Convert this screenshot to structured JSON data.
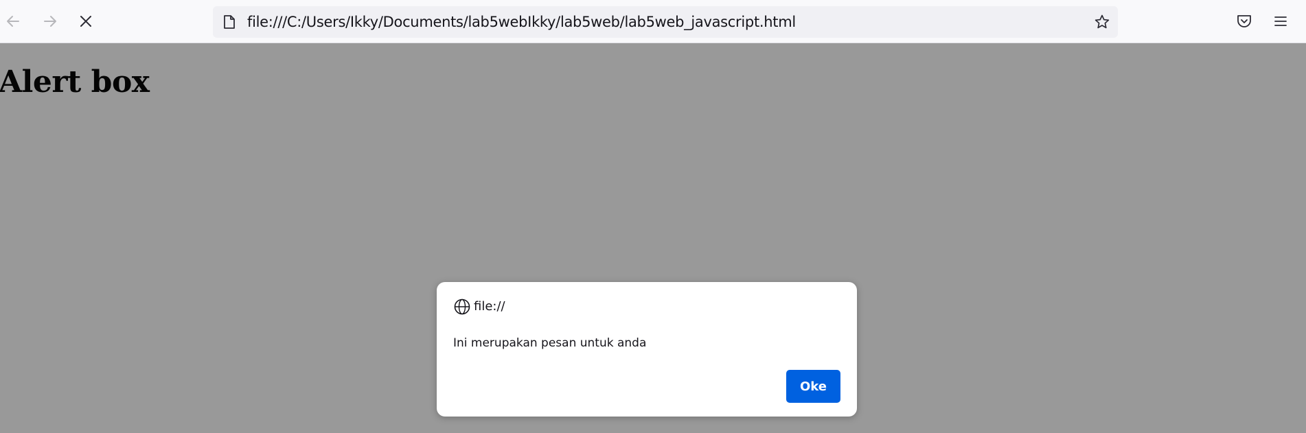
{
  "toolbar": {
    "back_icon": "back-arrow-icon",
    "forward_icon": "forward-arrow-icon",
    "stop_icon": "stop-loading-icon",
    "url": "file:///C:/Users/Ikky/Documents/lab5webIkky/lab5web/lab5web_javascript.html",
    "page_icon": "page-icon",
    "bookmark_icon": "star-icon",
    "pocket_icon": "pocket-icon",
    "menu_icon": "hamburger-menu-icon"
  },
  "page": {
    "heading": "Alert box"
  },
  "alert": {
    "origin": "file://",
    "origin_icon": "globe-icon",
    "message": "Ini merupakan pesan untuk anda",
    "ok_label": "Oke",
    "ok_color": "#0061e0"
  },
  "colors": {
    "toolbar_bg": "#f9f9fb",
    "urlbar_bg": "#f0f0f4",
    "overlay": "rgba(12,12,13,0.42)"
  }
}
